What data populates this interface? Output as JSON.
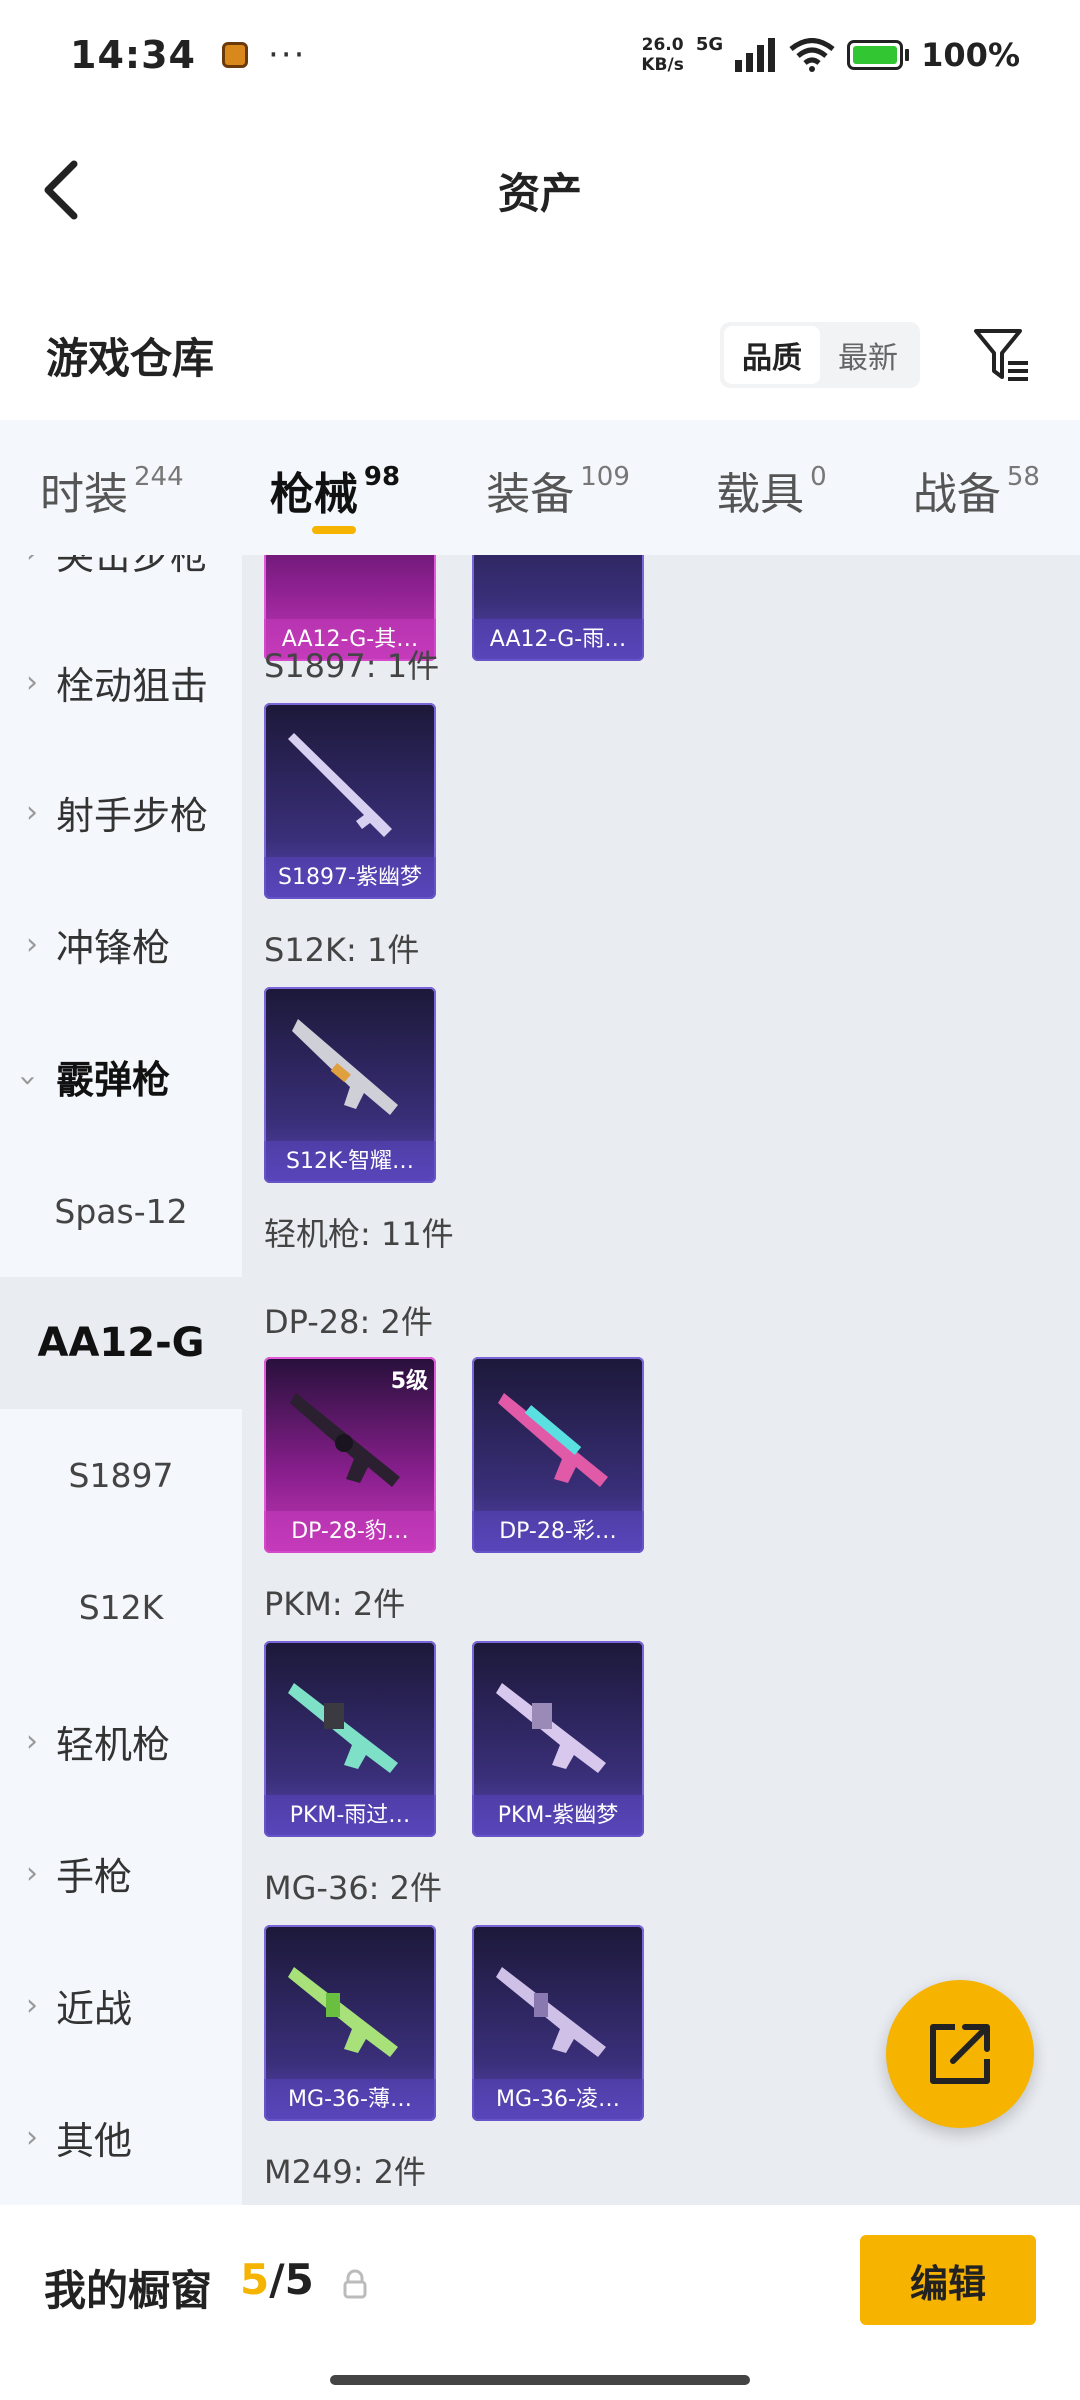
{
  "status": {
    "time": "14:34",
    "dots": "···",
    "net_speed_value": "26.0",
    "net_speed_unit": "KB/s",
    "network": "5G",
    "battery": "100%"
  },
  "nav": {
    "title": "资产"
  },
  "warehouse": {
    "title": "游戏仓库",
    "sort_options": [
      "品质",
      "最新"
    ],
    "active_sort": "品质"
  },
  "tabs": [
    {
      "label": "时装",
      "count": "244"
    },
    {
      "label": "枪械",
      "count": "98"
    },
    {
      "label": "装备",
      "count": "109"
    },
    {
      "label": "载具",
      "count": "0"
    },
    {
      "label": "战备",
      "count": "58"
    }
  ],
  "sidebar": {
    "items": [
      "突击步枪",
      "栓动狙击",
      "射手步枪",
      "冲锋枪",
      "霰弹枪",
      "轻机枪",
      "手枪",
      "近战",
      "其他"
    ],
    "sub_items": [
      "Spas-12",
      "AA12-G",
      "S1897",
      "S12K"
    ],
    "active_sub": "AA12-G"
  },
  "main": {
    "top_cards": [
      "AA12-G-其…",
      "AA12-G-雨…"
    ],
    "groups": [
      {
        "title": "S1897: 1件",
        "cards": [
          {
            "name": "S1897-紫幽梦"
          }
        ]
      },
      {
        "title": "S12K: 1件",
        "cards": [
          {
            "name": "S12K-智耀…"
          }
        ]
      },
      {
        "title": "轻机枪: 11件"
      },
      {
        "title": "DP-28: 2件",
        "cards": [
          {
            "name": "DP-28-豹…",
            "level": "5级"
          },
          {
            "name": "DP-28-彩…"
          }
        ]
      },
      {
        "title": "PKM: 2件",
        "cards": [
          {
            "name": "PKM-雨过…"
          },
          {
            "name": "PKM-紫幽梦"
          }
        ]
      },
      {
        "title": "MG-36: 2件",
        "cards": [
          {
            "name": "MG-36-薄…"
          },
          {
            "name": "MG-36-凌…"
          }
        ]
      },
      {
        "title": "M249: 2件"
      }
    ]
  },
  "bottom": {
    "title": "我的橱窗",
    "count_current": "5",
    "count_sep": "/",
    "count_total": "5",
    "edit_label": "编辑"
  },
  "colors": {
    "accent": "#f6b300",
    "rare_purple": "#5a47b8",
    "rare_pink": "#c23ab8"
  }
}
